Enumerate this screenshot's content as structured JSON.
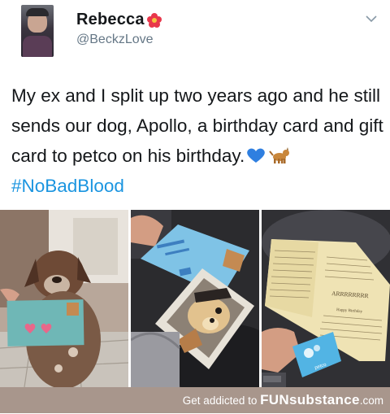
{
  "tweet": {
    "display_name": "Rebecca",
    "handle": "@BeckzLove",
    "text_before": "My ex and I split up two years ago and he still sends our dog, Apollo, a birthday card and gift card to petco on his birthday.",
    "hashtag": "#NoBadBlood",
    "icons": [
      "flower-emoji-icon",
      "blue-heart-emoji-icon",
      "dog-emoji-icon",
      "chevron-down-icon"
    ]
  },
  "photos": {
    "card_inside_text": "ARRRRRRRR",
    "card_inside_text2": "Happy Birthday",
    "gift_card_brand": "petco"
  },
  "footer": {
    "prefix": "Get addicted to ",
    "brand": "FUNsubstance",
    "domain": ".com"
  },
  "colors": {
    "hashtag": "#1b95e0",
    "footer_bg": "#a8968c",
    "name": "#14171a",
    "handle": "#657786"
  }
}
